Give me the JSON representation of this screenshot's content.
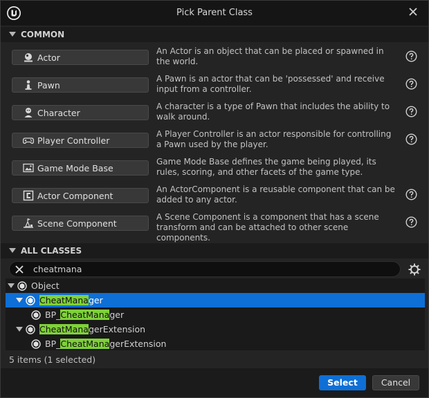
{
  "window": {
    "title": "Pick Parent Class"
  },
  "common": {
    "header": "COMMON",
    "items": [
      {
        "label": "Actor",
        "icon": "actor-icon",
        "description": "An Actor is an object that can be placed or spawned in the world."
      },
      {
        "label": "Pawn",
        "icon": "pawn-icon",
        "description": "A Pawn is an actor that can be 'possessed' and receive input from a controller."
      },
      {
        "label": "Character",
        "icon": "character-icon",
        "description": "A character is a type of Pawn that includes the ability to walk around."
      },
      {
        "label": "Player Controller",
        "icon": "gamepad-icon",
        "description": "A Player Controller is an actor responsible for controlling a Pawn used by the player."
      },
      {
        "label": "Game Mode Base",
        "icon": "game-mode-icon",
        "description": "Game Mode Base defines the game being played, its rules, scoring, and other facets of the game type."
      },
      {
        "label": "Actor Component",
        "icon": "actor-component-icon",
        "description": "An ActorComponent is a reusable component that can be added to any actor."
      },
      {
        "label": "Scene Component",
        "icon": "scene-component-icon",
        "description": "A Scene Component is a component that has a scene transform and can be attached to other scene components."
      }
    ]
  },
  "all_classes": {
    "header": "ALL CLASSES",
    "search_value": "cheatmana",
    "tree": [
      {
        "pre": "Object",
        "match": "",
        "post": ""
      },
      {
        "pre": "",
        "match": "CheatMana",
        "post": "ger"
      },
      {
        "pre": "BP_",
        "match": "CheatMana",
        "post": "ger"
      },
      {
        "pre": "",
        "match": "CheatMana",
        "post": "gerExtension"
      },
      {
        "pre": "BP_",
        "match": "CheatMana",
        "post": "gerExtension"
      }
    ],
    "status": "5 items (1 selected)"
  },
  "footer": {
    "select_label": "Select",
    "cancel_label": "Cancel"
  },
  "colors": {
    "accent": "#0e6fd6",
    "highlight": "#7fd13a",
    "background": "#242424"
  }
}
